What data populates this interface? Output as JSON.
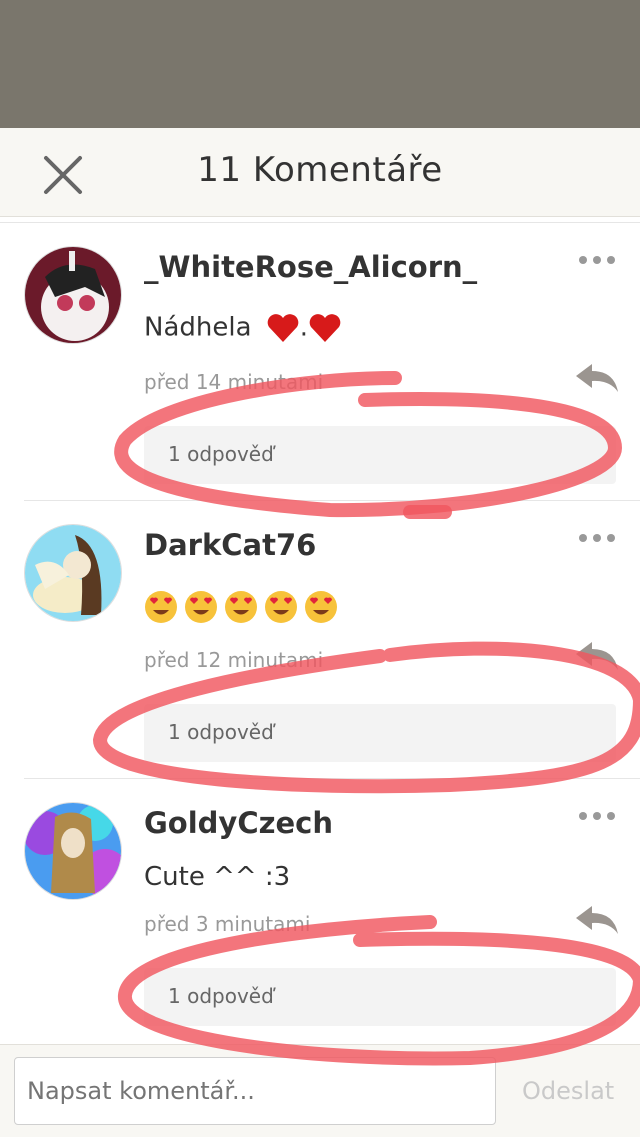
{
  "header": {
    "title": "11 Komentáře"
  },
  "comments": [
    {
      "username": "_WhiteRose_Alicorn_",
      "text": "Nádhela",
      "hearts": 2,
      "separator": ".",
      "time": "před 14 minutami",
      "replies": "1 odpověď"
    },
    {
      "username": "DarkCat76",
      "text": "",
      "emoji_count": 5,
      "time": "před 12 minutami",
      "replies": "1 odpověď"
    },
    {
      "username": "GoldyCzech",
      "text": "Cute ^^ :3",
      "time": "před 3 minutami",
      "replies": "1 odpověď"
    }
  ],
  "footer": {
    "placeholder": "Napsat komentář...",
    "send_label": "Odeslat"
  },
  "colors": {
    "header_bg": "#7a766c",
    "marker": "#f0575f"
  },
  "icons": [
    "close-icon",
    "more-icon",
    "reply-icon",
    "heart-emoji",
    "heart-eyes-emoji"
  ]
}
